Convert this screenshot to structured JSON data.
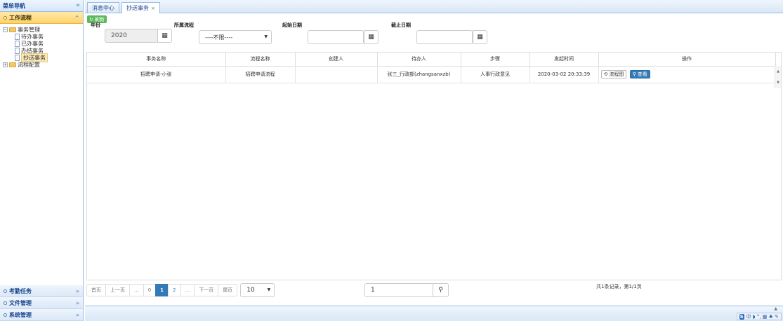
{
  "sidebar": {
    "title": "菜单导航",
    "collapse_icon": "«",
    "accordions": [
      {
        "label": "工作流程",
        "icon": "^"
      },
      {
        "label": "考勤任务",
        "icon": "»"
      },
      {
        "label": "文件管理",
        "icon": "»"
      },
      {
        "label": "系统管理",
        "icon": "»"
      }
    ],
    "tree": {
      "group1": {
        "toggle": "−",
        "label": "事务管理"
      },
      "items": [
        "待办事务",
        "已办事务",
        "办结事务",
        "抄送事务"
      ],
      "group2": {
        "toggle": "+",
        "label": "流程配置"
      }
    }
  },
  "tabs": [
    {
      "label": "消息中心"
    },
    {
      "label": "抄送事务",
      "close": "×"
    }
  ],
  "toolbar": {
    "refresh_label": "刷新",
    "refresh_icon": "↻"
  },
  "filters": {
    "year_label": "年份",
    "year_value": "2020",
    "process_label": "所属流程",
    "process_value": "----不限----",
    "start_label": "起始日期",
    "start_value": "",
    "end_label": "截止日期",
    "end_value": "",
    "calendar_icon": "▦",
    "caret": "▼"
  },
  "table": {
    "columns": [
      "事务名称",
      "流程名称",
      "创建人",
      "待办人",
      "步骤",
      "发起时间",
      "操作"
    ],
    "rows": [
      {
        "name": "招聘申请-小张",
        "process": "招聘申请流程",
        "creator": "",
        "assignee": "张三_行政部(zhangsanxzb)",
        "step": "人事行政意见",
        "time": "2020-03-02 20:33:39",
        "flow_label": "流程图",
        "flow_icon": "⟲",
        "view_label": "查看",
        "view_icon": "⚲"
      }
    ]
  },
  "pager": {
    "first": "首页",
    "prev": "上一页",
    "ellipsis": "...",
    "p0": "0",
    "current": "1",
    "p2": "2",
    "next": "下一页",
    "last": "尾页",
    "page_size": "10",
    "jump_value": "1",
    "search_icon": "⚲",
    "summary": "共1条记录，第1/1页"
  },
  "ime": {
    "logo": "S",
    "text": "中 ◗ °, ▦ ♣ ✎"
  },
  "colors": {
    "accent": "#337ab7",
    "refresh": "#5cb85c",
    "active_accordion": "#ffd36b",
    "border": "#99bbe8"
  }
}
